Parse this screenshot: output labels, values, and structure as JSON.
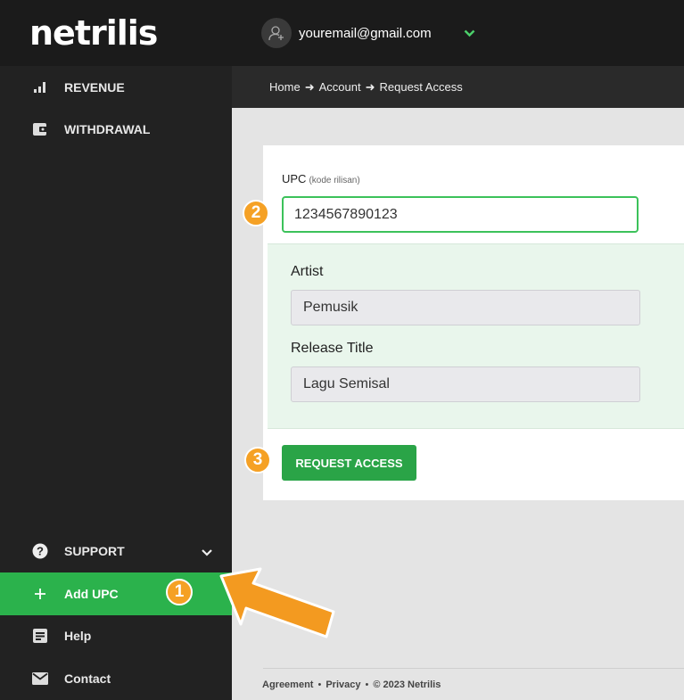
{
  "brand": {
    "logo": "netrilis"
  },
  "header": {
    "email": "youremail@gmail.com"
  },
  "breadcrumb": {
    "home": "Home",
    "account": "Account",
    "current": "Request Access",
    "separator": "➜"
  },
  "sidebar": {
    "revenue": "REVENUE",
    "withdrawal": "WITHDRAWAL",
    "support": "SUPPORT",
    "add_upc": "Add UPC",
    "help": "Help",
    "contact": "Contact"
  },
  "form": {
    "upc_label": "UPC",
    "upc_hint": "(kode rilisan)",
    "upc_value": "1234567890123",
    "artist_label": "Artist",
    "artist_value": "Pemusik",
    "release_label": "Release Title",
    "release_value": "Lagu Semisal",
    "submit_label": "REQUEST ACCESS"
  },
  "badges": {
    "one": "1",
    "two": "2",
    "three": "3"
  },
  "footer": {
    "agreement": "Agreement",
    "privacy": "Privacy",
    "copyright": "© 2023 Netrilis",
    "separator": "•"
  },
  "colors": {
    "accent_green": "#2bb24c",
    "badge_orange": "#f5a125",
    "sidebar_bg": "#222222"
  },
  "icons": [
    "bar-chart-icon",
    "wallet-icon",
    "question-icon",
    "chevron-down-icon",
    "plus-icon",
    "document-icon",
    "envelope-icon",
    "user-avatar-icon",
    "arrow-pointer-icon"
  ]
}
